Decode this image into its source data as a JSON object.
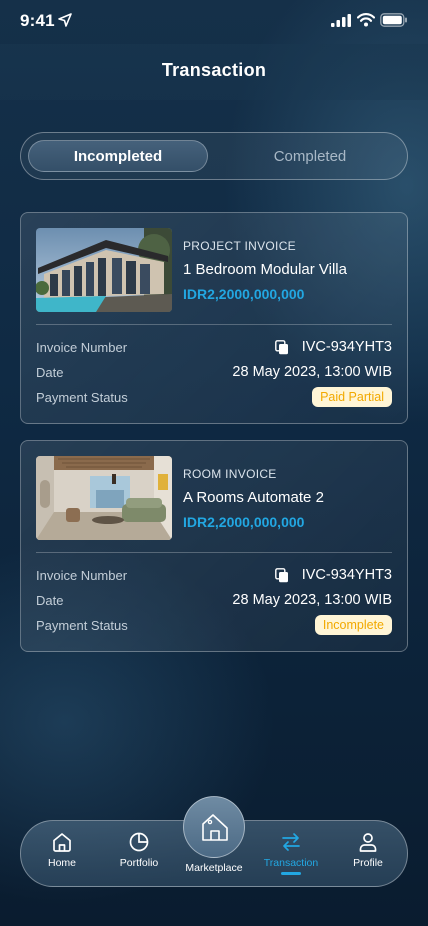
{
  "status_bar": {
    "time": "9:41"
  },
  "header": {
    "title": "Transaction"
  },
  "tabs": {
    "active": "Incompleted",
    "inactive": "Completed"
  },
  "labels": {
    "invoice_number": "Invoice Number",
    "date": "Date",
    "payment_status": "Payment Status"
  },
  "invoices": [
    {
      "type": "PROJECT INVOICE",
      "name": "1 Bedroom Modular Villa",
      "price": "IDR2,2000,000,000",
      "invoice_number": "IVC-934YHT3",
      "date": "28 May 2023, 13:00 WIB",
      "status": "Paid Partial"
    },
    {
      "type": "ROOM INVOICE",
      "name": "A Rooms Automate 2",
      "price": "IDR2,2000,000,000",
      "invoice_number": "IVC-934YHT3",
      "date": "28 May 2023, 13:00 WIB",
      "status": "Incomplete"
    }
  ],
  "nav": {
    "home": "Home",
    "portfolio": "Portfolio",
    "marketplace": "Marketplace",
    "transaction": "Transaction",
    "profile": "Profile",
    "active": "Transaction"
  },
  "colors": {
    "accent": "#22a7e2",
    "badge_text": "#f2a900",
    "badge_bg": "#fff5d6"
  },
  "icons": [
    "location-arrow-icon",
    "signal-icon",
    "wifi-icon",
    "battery-icon",
    "copy-icon",
    "home-icon",
    "pie-chart-icon",
    "store-tag-icon",
    "swap-arrows-icon",
    "user-icon"
  ]
}
